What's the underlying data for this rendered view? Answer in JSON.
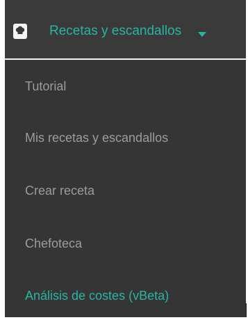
{
  "colors": {
    "header_background": "#3a3a3a",
    "menu_background": "#353535",
    "accent": "#2bb3a3",
    "menu_text": "#9c9c9c",
    "icon": "#f5f5f5"
  },
  "header": {
    "icon": "chef-hat-icon",
    "title": "Recetas y escandallos",
    "caret_icon": "caret-down-icon"
  },
  "menu": {
    "items": [
      {
        "label": "Tutorial",
        "active": false
      },
      {
        "label": "Mis recetas y escandallos",
        "active": false
      },
      {
        "label": "Crear receta",
        "active": false
      },
      {
        "label": "Chefoteca",
        "active": false
      },
      {
        "label": "Análisis de costes (vBeta)",
        "active": true
      }
    ]
  }
}
